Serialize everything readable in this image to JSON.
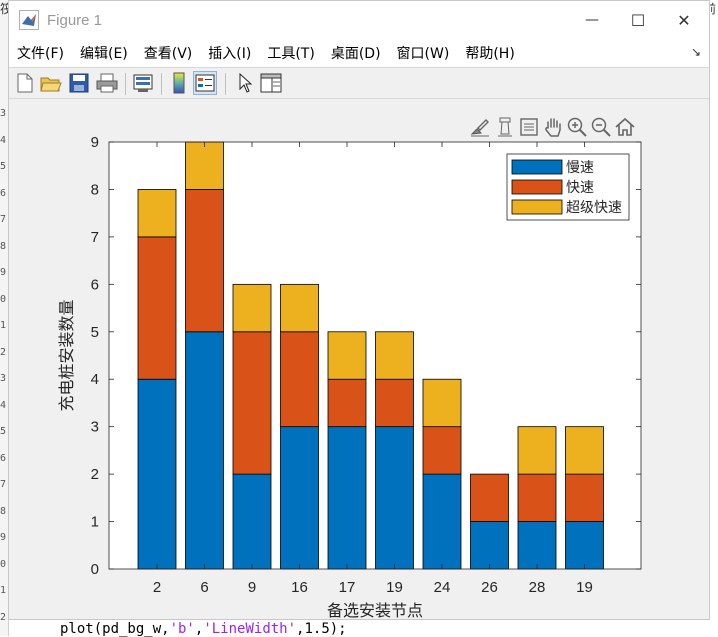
{
  "window": {
    "title": "Figure 1",
    "minimize_glyph": "—",
    "maximize_glyph": "☐",
    "close_glyph": "✕"
  },
  "menu": {
    "items": [
      "文件(F)",
      "编辑(E)",
      "查看(V)",
      "插入(I)",
      "工具(T)",
      "桌面(D)",
      "窗口(W)",
      "帮助(H)"
    ],
    "overflow_glyph": "↘"
  },
  "toolbar": {
    "buttons": [
      "new-figure-icon",
      "open-file-icon",
      "save-icon",
      "print-icon",
      "link-plot-icon",
      "colorbar-icon",
      "legend-icon",
      "pointer-icon",
      "property-inspector-icon"
    ],
    "active": "legend-icon"
  },
  "axes_toolbar": {
    "buttons": [
      "brush-icon",
      "data-tips-icon",
      "export-icon",
      "pan-icon",
      "zoom-in-icon",
      "zoom-out-icon",
      "home-icon"
    ]
  },
  "background": {
    "top_left_char": "筏",
    "top_right_char": "前",
    "line_numbers": [
      "3",
      "4",
      "5",
      "6",
      "7",
      "8",
      "9",
      "0",
      "1",
      "2",
      "3",
      "4",
      "5",
      "6",
      "7",
      "8",
      "9",
      "0",
      "1",
      "2"
    ],
    "code_line_prefix": "plot(pd_bg_w,",
    "code_line_string_1": "'b'",
    "code_line_mid": ",",
    "code_line_string_2": "'LineWidth'",
    "code_line_suffix": ",1.5);"
  },
  "colors": {
    "series_1": "#0072bd",
    "series_2": "#d95319",
    "series_3": "#edb120",
    "matlab_icon_blue": "#3c6eb4",
    "matlab_icon_orange": "#e16737"
  },
  "chart_data": {
    "type": "bar",
    "stacked": true,
    "categories": [
      "2",
      "6",
      "9",
      "16",
      "17",
      "19",
      "24",
      "26",
      "28",
      "19"
    ],
    "series": [
      {
        "name": "慢速",
        "values": [
          4,
          5,
          2,
          3,
          3,
          3,
          2,
          1,
          1,
          1
        ]
      },
      {
        "name": "快速",
        "values": [
          3,
          3,
          3,
          2,
          1,
          1,
          1,
          1,
          1,
          1
        ]
      },
      {
        "name": "超级快速",
        "values": [
          1,
          1,
          1,
          1,
          1,
          1,
          1,
          0,
          1,
          1
        ]
      }
    ],
    "xlabel": "备选安装节点",
    "ylabel": "充电桩安装数量",
    "ylim": [
      0,
      9
    ],
    "yticks": [
      0,
      1,
      2,
      3,
      4,
      5,
      6,
      7,
      8,
      9
    ],
    "grid": false,
    "legend_position": "top-right"
  }
}
